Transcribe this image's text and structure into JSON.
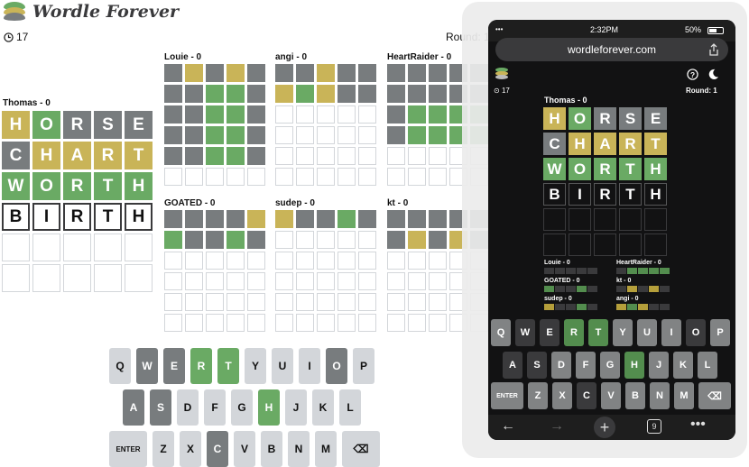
{
  "header": {
    "logo_text": "Wordle Forever",
    "timer": "17",
    "round": "Round: 1"
  },
  "colors": {
    "correct": "#6aaa64",
    "present": "#c9b458",
    "absent": "#787c7e",
    "empty_border": "#d3d6da",
    "key": "#d3d6da"
  },
  "main_player": {
    "name": "Thomas - 0",
    "rows": [
      {
        "letters": [
          "H",
          "O",
          "R",
          "S",
          "E"
        ],
        "states": [
          "y",
          "g",
          "d",
          "d",
          "d"
        ]
      },
      {
        "letters": [
          "C",
          "H",
          "A",
          "R",
          "T"
        ],
        "states": [
          "d",
          "y",
          "y",
          "y",
          "y"
        ]
      },
      {
        "letters": [
          "W",
          "O",
          "R",
          "T",
          "H"
        ],
        "states": [
          "g",
          "g",
          "g",
          "g",
          "g"
        ]
      },
      {
        "letters": [
          "B",
          "I",
          "R",
          "T",
          "H"
        ],
        "states": [
          "t",
          "t",
          "t",
          "t",
          "t"
        ]
      },
      {
        "letters": [
          "",
          "",
          "",
          "",
          ""
        ],
        "states": [
          "e",
          "e",
          "e",
          "e",
          "e"
        ]
      },
      {
        "letters": [
          "",
          "",
          "",
          "",
          ""
        ],
        "states": [
          "e",
          "e",
          "e",
          "e",
          "e"
        ]
      }
    ]
  },
  "opponents": [
    {
      "name": "Louie - 0",
      "rows": [
        [
          "d",
          "y",
          "d",
          "y",
          "d"
        ],
        [
          "d",
          "d",
          "g",
          "g",
          "d"
        ],
        [
          "d",
          "d",
          "g",
          "g",
          "d"
        ],
        [
          "d",
          "d",
          "g",
          "g",
          "d"
        ],
        [
          "d",
          "d",
          "g",
          "g",
          "d"
        ],
        [
          "e",
          "e",
          "e",
          "e",
          "e"
        ]
      ]
    },
    {
      "name": "angi - 0",
      "rows": [
        [
          "d",
          "d",
          "y",
          "d",
          "d"
        ],
        [
          "y",
          "g",
          "y",
          "d",
          "d"
        ],
        [
          "e",
          "e",
          "e",
          "e",
          "e"
        ],
        [
          "e",
          "e",
          "e",
          "e",
          "e"
        ],
        [
          "e",
          "e",
          "e",
          "e",
          "e"
        ],
        [
          "e",
          "e",
          "e",
          "e",
          "e"
        ]
      ]
    },
    {
      "name": "HeartRaider - 0",
      "rows": [
        [
          "d",
          "d",
          "d",
          "d",
          "d"
        ],
        [
          "d",
          "d",
          "d",
          "d",
          "d"
        ],
        [
          "d",
          "g",
          "g",
          "g",
          "g"
        ],
        [
          "d",
          "g",
          "g",
          "g",
          "g"
        ],
        [
          "e",
          "e",
          "e",
          "e",
          "e"
        ],
        [
          "e",
          "e",
          "e",
          "e",
          "e"
        ]
      ]
    },
    {
      "name": "GOATED - 0",
      "rows": [
        [
          "d",
          "d",
          "d",
          "d",
          "y"
        ],
        [
          "g",
          "d",
          "d",
          "g",
          "d"
        ],
        [
          "e",
          "e",
          "e",
          "e",
          "e"
        ],
        [
          "e",
          "e",
          "e",
          "e",
          "e"
        ],
        [
          "e",
          "e",
          "e",
          "e",
          "e"
        ],
        [
          "e",
          "e",
          "e",
          "e",
          "e"
        ]
      ]
    },
    {
      "name": "sudep - 0",
      "rows": [
        [
          "y",
          "d",
          "d",
          "g",
          "d"
        ],
        [
          "e",
          "e",
          "e",
          "e",
          "e"
        ],
        [
          "e",
          "e",
          "e",
          "e",
          "e"
        ],
        [
          "e",
          "e",
          "e",
          "e",
          "e"
        ],
        [
          "e",
          "e",
          "e",
          "e",
          "e"
        ],
        [
          "e",
          "e",
          "e",
          "e",
          "e"
        ]
      ]
    },
    {
      "name": "kt - 0",
      "rows": [
        [
          "d",
          "d",
          "d",
          "d",
          "d"
        ],
        [
          "d",
          "y",
          "d",
          "y",
          "d"
        ],
        [
          "e",
          "e",
          "e",
          "e",
          "e"
        ],
        [
          "e",
          "e",
          "e",
          "e",
          "e"
        ],
        [
          "e",
          "e",
          "e",
          "e",
          "e"
        ],
        [
          "e",
          "e",
          "e",
          "e",
          "e"
        ]
      ]
    }
  ],
  "keyboard": {
    "rows": [
      [
        {
          "k": "Q",
          "s": ""
        },
        {
          "k": "W",
          "s": "d"
        },
        {
          "k": "E",
          "s": "d"
        },
        {
          "k": "R",
          "s": "g"
        },
        {
          "k": "T",
          "s": "g"
        },
        {
          "k": "Y",
          "s": ""
        },
        {
          "k": "U",
          "s": ""
        },
        {
          "k": "I",
          "s": ""
        },
        {
          "k": "O",
          "s": "d"
        },
        {
          "k": "P",
          "s": ""
        }
      ],
      [
        {
          "k": "A",
          "s": "d"
        },
        {
          "k": "S",
          "s": "d"
        },
        {
          "k": "D",
          "s": ""
        },
        {
          "k": "F",
          "s": ""
        },
        {
          "k": "G",
          "s": ""
        },
        {
          "k": "H",
          "s": "g"
        },
        {
          "k": "J",
          "s": ""
        },
        {
          "k": "K",
          "s": ""
        },
        {
          "k": "L",
          "s": ""
        }
      ],
      [
        {
          "k": "ENTER",
          "s": ""
        },
        {
          "k": "Z",
          "s": ""
        },
        {
          "k": "X",
          "s": ""
        },
        {
          "k": "C",
          "s": "d"
        },
        {
          "k": "V",
          "s": ""
        },
        {
          "k": "B",
          "s": ""
        },
        {
          "k": "N",
          "s": ""
        },
        {
          "k": "M",
          "s": ""
        },
        {
          "k": "⌫",
          "s": ""
        }
      ]
    ]
  },
  "phone": {
    "time": "2:32PM",
    "battery": "50%",
    "url": "wordleforever.com",
    "timer": "17",
    "round": "Round: 1",
    "tab_count": "9",
    "opponents_mini": [
      {
        "name": "Louie - 0",
        "cells": [
          "d",
          "d",
          "d",
          "d",
          "d"
        ]
      },
      {
        "name": "HeartRaider - 0",
        "cells": [
          "d",
          "g",
          "g",
          "g",
          "g"
        ]
      },
      {
        "name": "GOATED - 0",
        "cells": [
          "g",
          "d",
          "d",
          "g",
          "d"
        ]
      },
      {
        "name": "kt - 0",
        "cells": [
          "d",
          "y",
          "d",
          "y",
          "d"
        ]
      },
      {
        "name": "sudep - 0",
        "cells": [
          "y",
          "d",
          "d",
          "g",
          "d"
        ]
      },
      {
        "name": "angi - 0",
        "cells": [
          "y",
          "g",
          "y",
          "d",
          "d"
        ]
      }
    ]
  }
}
